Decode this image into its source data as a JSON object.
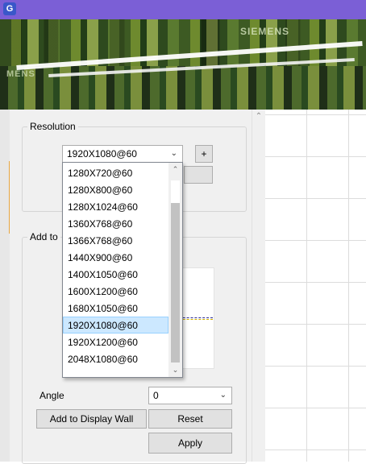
{
  "app": {
    "icon_letter": "G"
  },
  "banner": {
    "brand_text": "SIEMENS",
    "brand_text_partial": "MENS"
  },
  "resolution_group": {
    "title": "Resolution",
    "selected": "1920X1080@60",
    "add_button": "+"
  },
  "add_group": {
    "title": "Add to"
  },
  "dropdown": {
    "options": [
      "1280X720@60",
      "1280X800@60",
      "1280X1024@60",
      "1360X768@60",
      "1366X768@60",
      "1440X900@60",
      "1400X1050@60",
      "1600X1200@60",
      "1680X1050@60",
      "1920X1080@60",
      "1920X1200@60",
      "2048X1080@60"
    ],
    "selected_index": 9
  },
  "angle": {
    "label": "Angle",
    "value": "0"
  },
  "buttons": {
    "add_to_wall": "Add to Display Wall",
    "reset": "Reset",
    "apply": "Apply"
  },
  "colors": {
    "titlebar": "#7b5fd6",
    "selection": "#cce8ff",
    "selection_border": "#99d1ff"
  },
  "icons": {
    "chevron": "chevron-down-icon",
    "scroll_up": "scroll-up-arrow-icon",
    "scroll_down": "scroll-down-arrow-icon"
  }
}
